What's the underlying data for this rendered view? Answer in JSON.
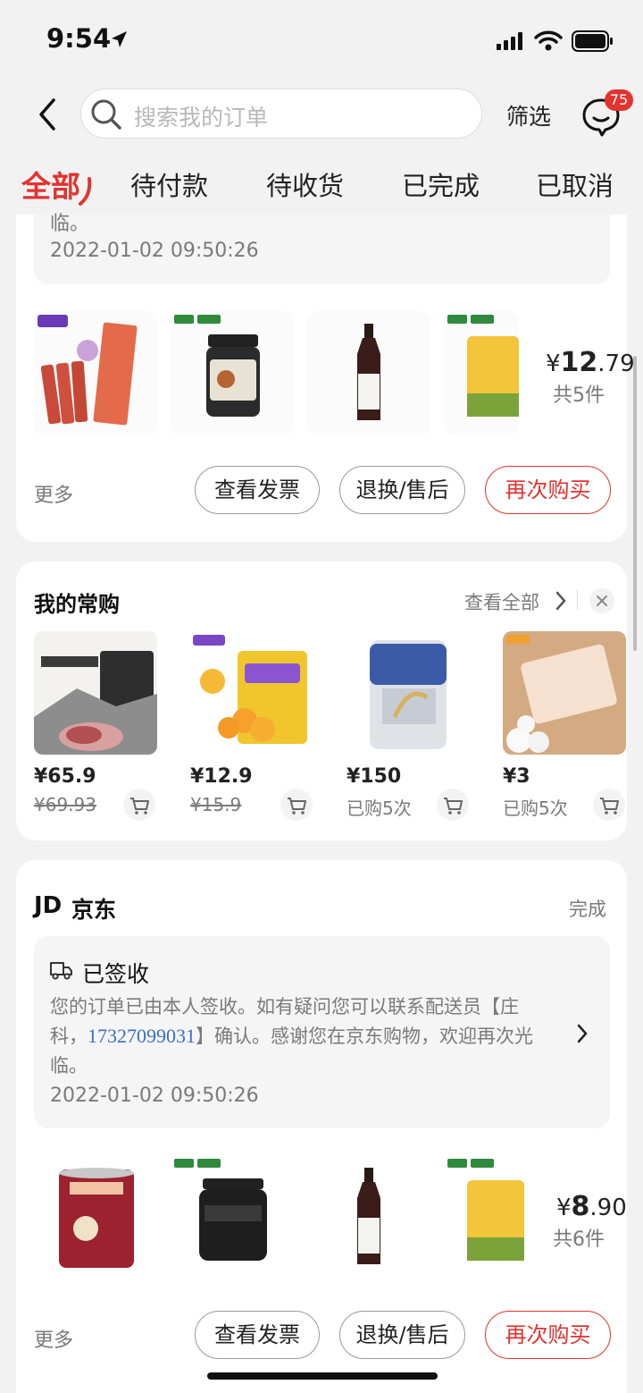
{
  "status": {
    "time": "9:54"
  },
  "search": {
    "placeholder": "搜索我的订单"
  },
  "header": {
    "filter": "筛选",
    "badge": "75"
  },
  "tabs": [
    "全部",
    "待付款",
    "待收货",
    "已完成",
    "已取消"
  ],
  "order1": {
    "message_tail": "临。",
    "timestamp": "2022-01-02 09:50:26",
    "price_symbol": "¥",
    "price_int": "12",
    "price_dec": ".79",
    "count": "共5件",
    "more": "更多",
    "buttons": [
      "查看发票",
      "退换/售后",
      "再次购买"
    ]
  },
  "frequent": {
    "title": "我的常购",
    "view_all": "查看全部",
    "items": [
      {
        "price": "¥65.9",
        "sub": "¥69.93"
      },
      {
        "price": "¥12.9",
        "sub": "¥15.9"
      },
      {
        "price": "¥150",
        "sub": "已购5次"
      },
      {
        "price": "¥3",
        "sub": "已购5次"
      }
    ]
  },
  "order2": {
    "shop_logo": "JD",
    "shop": "京东",
    "status": "完成",
    "delivery_title": "已签收",
    "message_a": "您的订单已由本人签收。如有疑问您可以联系配送员【庄",
    "message_b1": "科，",
    "phone": "17327099031",
    "message_b2": "】确认。感谢您在京东购物，欢迎再次光",
    "message_c": "临。",
    "timestamp": "2022-01-02 09:50:26",
    "price_symbol": "¥",
    "price_int": "8",
    "price_dec": ".90",
    "count": "共6件",
    "more": "更多",
    "buttons": [
      "查看发票",
      "退换/售后",
      "再次购买"
    ]
  },
  "colors": {
    "accent": "#e3332f",
    "background": "#f2f2f2"
  }
}
